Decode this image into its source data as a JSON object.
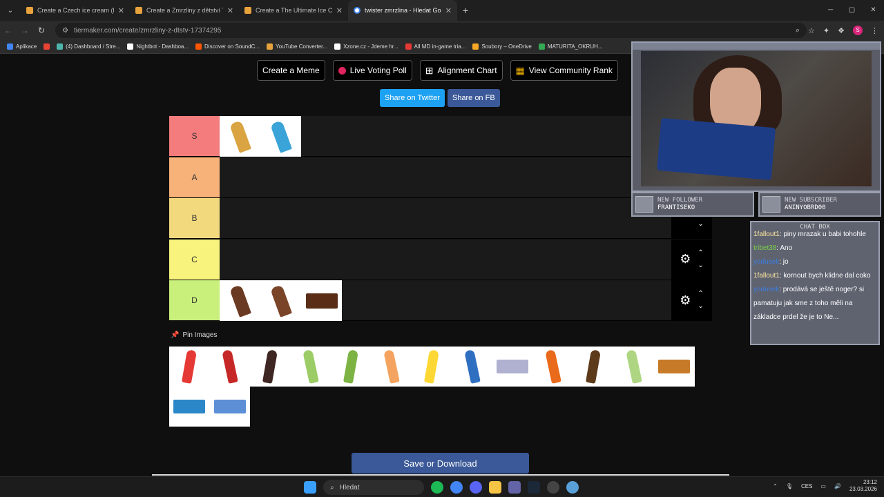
{
  "browser": {
    "tabs": [
      {
        "title": "Create a Czech ice cream (ledň",
        "active": false
      },
      {
        "title": "Create a Zmrzliny z dětství Tier",
        "active": false
      },
      {
        "title": "Create a The Ultimate Ice Cream",
        "active": false
      },
      {
        "title": "twister zmrzlina - Hledat Googl",
        "active": true
      }
    ],
    "url": "tiermaker.com/create/zmrzliny-z-dtstv-17374295",
    "bookmarks": [
      {
        "label": "Aplikace",
        "color": "#4285f4"
      },
      {
        "label": "",
        "color": "#ea4335"
      },
      {
        "label": "(4) Dashboard / Stre...",
        "color": "#4db6ac"
      },
      {
        "label": "Nightbot - Dashboa...",
        "color": "#ffffff"
      },
      {
        "label": "Discover on SoundC...",
        "color": "#ff5500"
      },
      {
        "label": "YouTube Converter...",
        "color": "#e8a33d"
      },
      {
        "label": "Xzone.cz - Jdeme hr...",
        "color": "#ffffff"
      },
      {
        "label": "All MD in-game tria...",
        "color": "#e53935"
      },
      {
        "label": "Soubory – OneDrive",
        "color": "#f9a825"
      },
      {
        "label": "MATURITA_OKRUH...",
        "color": "#34a853"
      }
    ]
  },
  "toolbar": {
    "create_meme": "Create a Meme",
    "live_voting": "Live Voting Poll",
    "alignment_chart": "Alignment Chart",
    "community_rank": "View Community Rank",
    "share_twitter": "Share on Twitter",
    "share_fb": "Share on FB"
  },
  "tiers": [
    {
      "label": "S",
      "color": "#f47c7c",
      "items": [
        "#d9a441",
        "#3aa4d8"
      ]
    },
    {
      "label": "A",
      "color": "#f7b27a",
      "items": []
    },
    {
      "label": "B",
      "color": "#f3d97e",
      "items": []
    },
    {
      "label": "C",
      "color": "#f7f37c",
      "items": []
    },
    {
      "label": "D",
      "color": "#c9f07b",
      "items": [
        "#6b3a22",
        "#7a4428",
        "#5a2e16"
      ]
    }
  ],
  "pin_label": "Pin Images",
  "pool_items": [
    "#e53935",
    "#c62828",
    "#3e2723",
    "#9ccc65",
    "#7cb342",
    "#f4a460",
    "#fdd835",
    "#2f6fc1",
    "#b0b0d0",
    "#e86a1a",
    "#5d3a1a",
    "#aed581",
    "#c77a28",
    "#2b87c8",
    "#5c8fd6"
  ],
  "save_button": "Save or Download",
  "stream": {
    "follower_heading": "NEW FOLLOWER",
    "follower_name": "FRANTISEKO",
    "subscriber_heading": "NEW SUBSCRIBER",
    "subscriber_name": "ANINYOBRD00",
    "chat_title": "CHAT BOX",
    "messages": [
      {
        "user": "1fallout1",
        "text": ": piny mrazak u babi tohohle",
        "color": "u3"
      },
      {
        "user": "tribet38",
        "text": ": Ano",
        "color": "u1"
      },
      {
        "user": "yodusek",
        "text": ": jo",
        "color": "u2"
      },
      {
        "user": "1fallout1",
        "text": ": kornout bych klidne dal coko",
        "color": "u3"
      },
      {
        "user": "yodusek",
        "text": ": prodává se ještě noger? si pamatuju jak sme z toho měli na základce prdel že je to Ne...",
        "color": "u2"
      }
    ]
  },
  "taskbar": {
    "search": "Hledat",
    "lang": "CES",
    "time": "23:12",
    "date": "23.03.2026"
  }
}
